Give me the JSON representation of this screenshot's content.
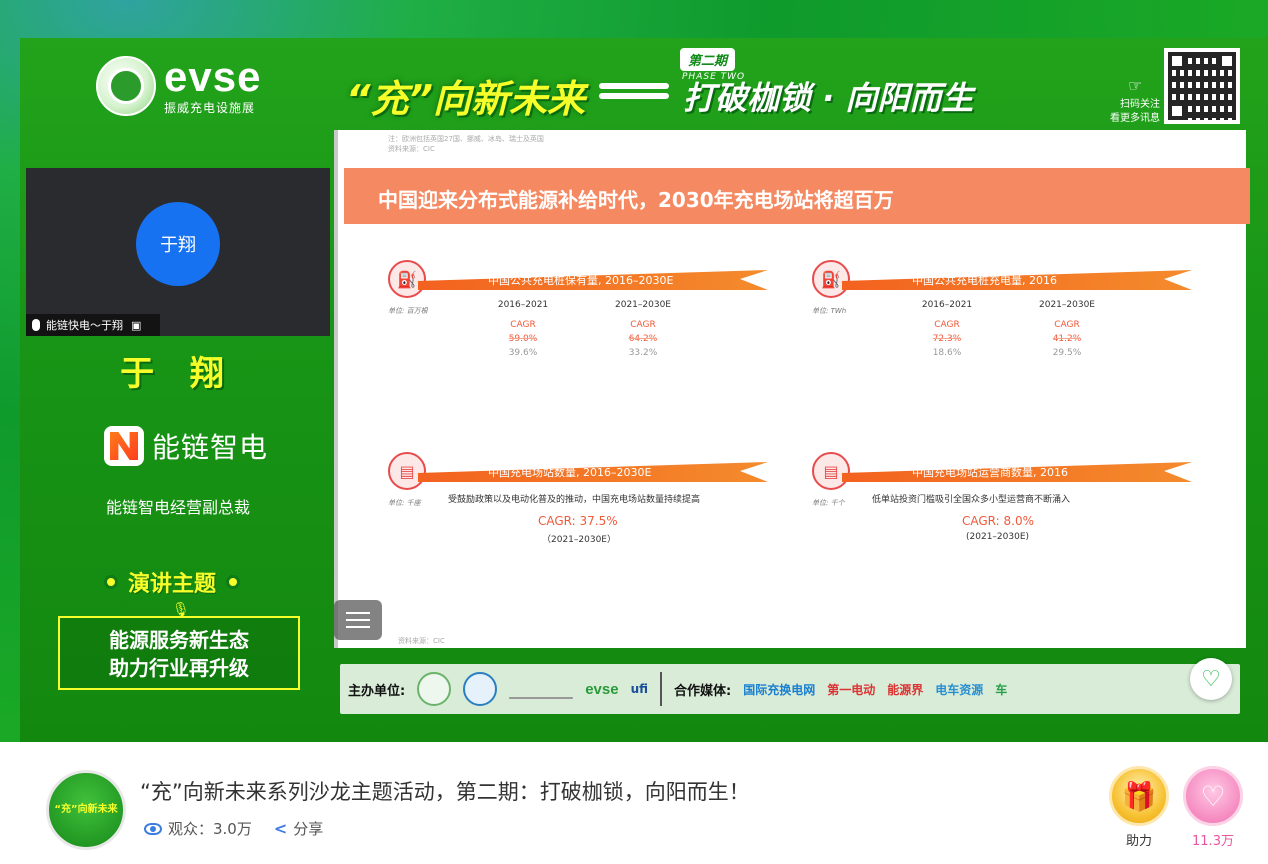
{
  "header": {
    "logo_text": "evse",
    "logo_subtitle": "振威充电设施展",
    "banner_main": "“充”向新未来",
    "banner_phase": "第二期",
    "banner_phase_en": "PHASE TWO",
    "banner_sub": "打破枷锁 · 向阳而生",
    "qr_caption": "扫码关注\n看更多讯息"
  },
  "speaker": {
    "video_avatar_text": "于翔",
    "video_label": "能链快电～于翔",
    "name": "于 翔",
    "company": "能链智电",
    "title": "能链智电经营副总裁",
    "topic_heading": "演讲主题",
    "topic_line1": "能源服务新生态",
    "topic_line2": "助力行业再升级"
  },
  "slide": {
    "note_line1": "注：欧洲包括英国27国、挪威、冰岛、瑞士及英国",
    "note_line2": "资料来源：CIC",
    "title": "中国迎来分布式能源补给时代，2030年充电场站将超百万",
    "quadrants": [
      {
        "ribbon": "中国公共充电桩保有量, 2016–2030E",
        "unit": "单位: 百万根",
        "col1_period": "2016–2021",
        "col1_cagr_label": "CAGR",
        "col1_value_a": "59.0%",
        "col1_value_b": "39.6%",
        "col2_period": "2021–2030E",
        "col2_cagr_label": "CAGR",
        "col2_value_a": "64.2%",
        "col2_value_b": "33.2%"
      },
      {
        "ribbon": "中国公共充电桩充电量, 2016",
        "unit": "单位: TWh",
        "col1_period": "2016–2021",
        "col1_cagr_label": "CAGR",
        "col1_value_a": "72.3%",
        "col1_value_b": "18.6%",
        "col2_period": "2021–2030E",
        "col2_cagr_label": "CAGR",
        "col2_value_a": "41.2%",
        "col2_value_b": "29.5%"
      },
      {
        "ribbon": "中国充电场站数量, 2016–2030E",
        "unit": "单位: 千座",
        "desc": "受鼓励政策以及电动化普及的推动，中国充电场站数量持续提高",
        "cagr": "CAGR: 37.5%",
        "period": "（2021–2030E）"
      },
      {
        "ribbon": "中国充电场站运营商数量, 2016",
        "unit": "单位: 千个",
        "desc": "低单站投资门槛吸引全国众多小型运营商不断涌入",
        "cagr": "CAGR: 8.0%",
        "period": "(2021–2030E)"
      }
    ],
    "source": "资料来源：CIC"
  },
  "sponsors": {
    "organizer_label": "主办单位:",
    "organizer_evse": "evse",
    "organizer_ufi": "ufi",
    "media_label": "合作媒体:",
    "media": [
      "国际充换电网",
      "第一电动",
      "能源界",
      "电车资源",
      "车"
    ]
  },
  "footer": {
    "channel_avatar_text": "“充”向新未来",
    "event_title": "“充”向新未来系列沙龙主题活动，第二期：打破枷锁，向阳而生！",
    "viewers_label": "观众：3.0万",
    "share_label": "分享",
    "gift_label": "助力",
    "like_count": "11.3万"
  },
  "colors": {
    "brand_green": "#189516",
    "accent_yellow": "#f7ff2b",
    "slide_orange": "#f58a62",
    "link_blue": "#3d7ce0",
    "like_pink": "#e9589f"
  }
}
